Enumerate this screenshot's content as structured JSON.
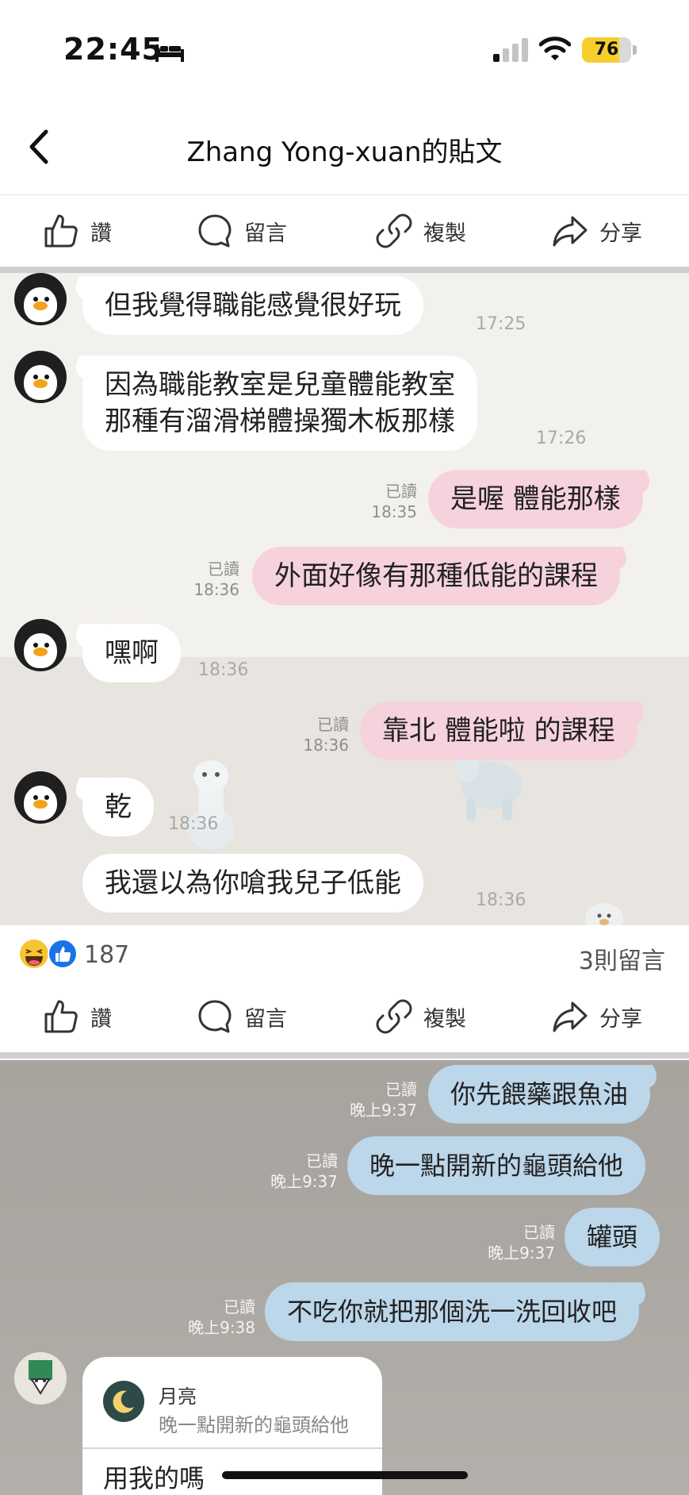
{
  "status_bar": {
    "time": "22:45",
    "battery": "76"
  },
  "header": {
    "title": "Zhang Yong-xuan的貼文"
  },
  "actions": {
    "like": "讚",
    "comment": "留言",
    "copy": "複製",
    "share": "分享"
  },
  "chat1": {
    "messages": [
      {
        "side": "left",
        "text": "但我覺得職能感覺很好玩",
        "time": "17:25"
      },
      {
        "side": "left",
        "text": "因為職能教室是兒童體能教室",
        "text2": "那種有溜滑梯體操獨木板那樣",
        "time": "17:26"
      },
      {
        "side": "right",
        "text": "是喔 體能那樣",
        "read": "已讀",
        "time": "18:35"
      },
      {
        "side": "right",
        "text": "外面好像有那種低能的課程",
        "read": "已讀",
        "time": "18:36"
      },
      {
        "side": "left",
        "text": "嘿啊",
        "time": "18:36"
      },
      {
        "side": "right",
        "text": "靠北 體能啦 的課程",
        "read": "已讀",
        "time": "18:36"
      },
      {
        "side": "left",
        "text": "乾",
        "time": "18:36"
      },
      {
        "side": "left",
        "text": "我還以為你嗆我兒子低能",
        "time": "18:36"
      }
    ]
  },
  "reactions": {
    "count": "187",
    "comments": "3則留言"
  },
  "chat2": {
    "messages": [
      {
        "text": "你先餵藥跟魚油",
        "read": "已讀",
        "time": "晚上9:37"
      },
      {
        "text": "晚一點開新的龜頭給他",
        "read": "已讀",
        "time": "晚上9:37"
      },
      {
        "text": "罐頭",
        "read": "已讀",
        "time": "晚上9:37"
      },
      {
        "text": "不吃你就把那個洗一洗回收吧",
        "read": "已讀",
        "time": "晚上9:38"
      }
    ],
    "reply": {
      "name": "月亮",
      "quote": "晚一點開新的龜頭給他",
      "text": "用我的嗎"
    }
  },
  "colors": {
    "pink_bubble": "#f6d3dc",
    "blue_bubble": "#bcd6ea",
    "battery": "#f6cf2d"
  },
  "icons": [
    "bed-icon",
    "signal-icon",
    "wifi-icon",
    "battery-icon",
    "back-chevron-icon",
    "thumbs-up-icon",
    "comment-bubble-icon",
    "link-icon",
    "share-arrow-icon",
    "laugh-emoji-icon",
    "like-emoji-icon",
    "penguin-avatar",
    "moon-icon"
  ]
}
